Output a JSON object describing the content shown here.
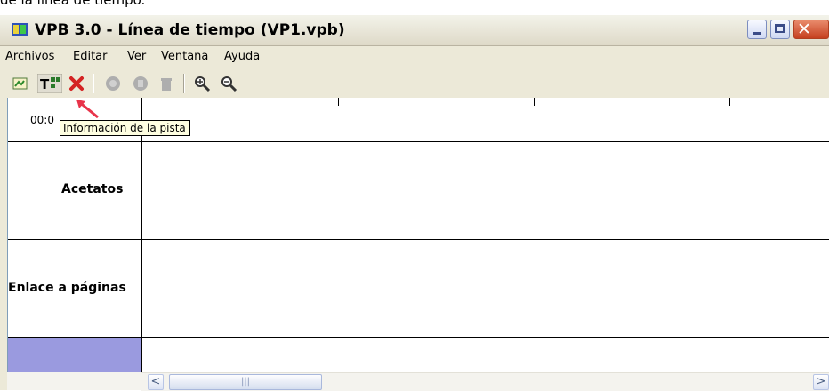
{
  "caption_fragment": "de la línea de tiempo.",
  "window": {
    "title": "VPB 3.0 - Línea de tiempo (VP1.vpb)"
  },
  "menu": {
    "items": [
      "Archivos",
      "Editar",
      "Ver",
      "Ventana",
      "Ayuda"
    ]
  },
  "toolbar": {
    "icons": [
      "open-icon",
      "track-info-icon",
      "delete-icon",
      "record-icon",
      "pause-icon",
      "trash-icon",
      "zoom-in-icon",
      "zoom-out-icon"
    ]
  },
  "timeline": {
    "time_label": "00:0",
    "tracks": [
      "Acetatos",
      "Enlace a páginas",
      ""
    ]
  },
  "tooltip": "Información de la pista",
  "scrollbar": {
    "left_arrow": "<",
    "right_arrow": ">",
    "thumb_grip": "|||"
  },
  "colors": {
    "title_bar": "#ece9d8",
    "close_button": "#c5401f",
    "tooltip_bg": "#ffffe1",
    "track_highlight": "#9a9adf",
    "annotation_arrow": "#e8344a"
  }
}
